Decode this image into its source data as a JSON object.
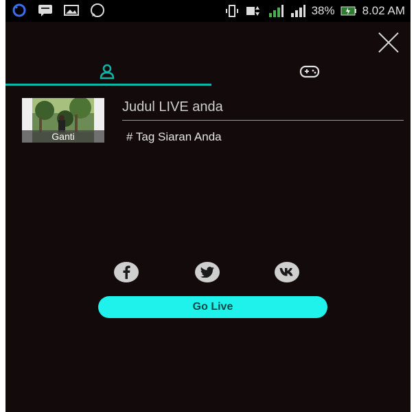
{
  "status_bar": {
    "battery_percent": "38%",
    "time": "8.02 AM",
    "left_icons": [
      "sync-icon",
      "chat-icon",
      "image-icon",
      "whatsapp-icon"
    ],
    "right_icons": [
      "vibrate-icon",
      "sim-data-icon",
      "signal-icon",
      "signal-icon",
      "battery-charging-icon"
    ]
  },
  "tabs": [
    {
      "icon": "user-icon",
      "active": true
    },
    {
      "icon": "gamepad-icon",
      "active": false
    }
  ],
  "thumbnail": {
    "change_label": "Ganti"
  },
  "form": {
    "title_placeholder": "Judul LIVE anda",
    "tag_placeholder": "# Tag Siaran Anda"
  },
  "share": [
    {
      "network": "facebook",
      "icon": "facebook-icon"
    },
    {
      "network": "twitter",
      "icon": "twitter-icon"
    },
    {
      "network": "vk",
      "icon": "vk-icon"
    }
  ],
  "go_live_label": "Go Live",
  "colors": {
    "accent": "#10b5aa",
    "button": "#1ef2ea",
    "background": "#130b0b"
  }
}
